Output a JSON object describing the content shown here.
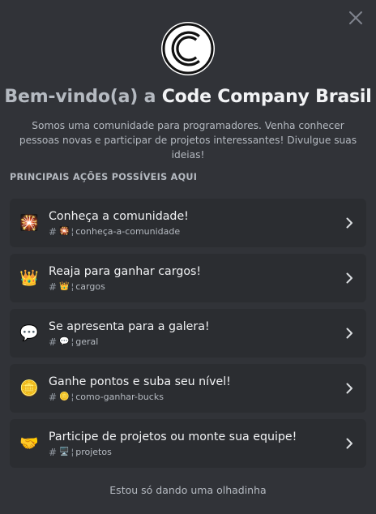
{
  "modal": {
    "title_prefix": "Bem-vindo(a) a ",
    "server_name": "Code Company Brasil",
    "description": "Somos uma comunidade para programadores. Venha conhecer pessoas novas e participar de projetos interessantes! Divulgue suas ideias!",
    "section_label": "PRINCIPAIS AÇÕES POSSÍVEIS AQUI",
    "footer_link": "Estou só dando uma olhadinha"
  },
  "actions": [
    {
      "emoji": "🎇",
      "title": "Conheça a comunidade!",
      "channel_emoji": "🎇",
      "channel": "conheça-a-comunidade"
    },
    {
      "emoji": "👑",
      "title": "Reaja para ganhar cargos!",
      "channel_emoji": "👑",
      "channel": "cargos"
    },
    {
      "emoji": "💬",
      "title": "Se apresenta para a galera!",
      "channel_emoji": "💬",
      "channel": "geral"
    },
    {
      "emoji": "🪙",
      "title": "Ganhe pontos e suba seu nível!",
      "channel_emoji": "🪙",
      "channel": "como-ganhar-bucks"
    },
    {
      "emoji": "🤝",
      "title": "Participe de projetos ou monte sua equipe!",
      "channel_emoji": "🖥️",
      "channel": "projetos"
    }
  ],
  "icons": {
    "close": "close-icon",
    "logo": "server-logo-icon",
    "chevron": "chevron-right-icon",
    "hash": "#",
    "separator": "¦"
  },
  "colors": {
    "background": "#313338",
    "card": "#2b2d31",
    "text_primary": "#f2f3f5",
    "text_muted": "#b5bac1"
  }
}
